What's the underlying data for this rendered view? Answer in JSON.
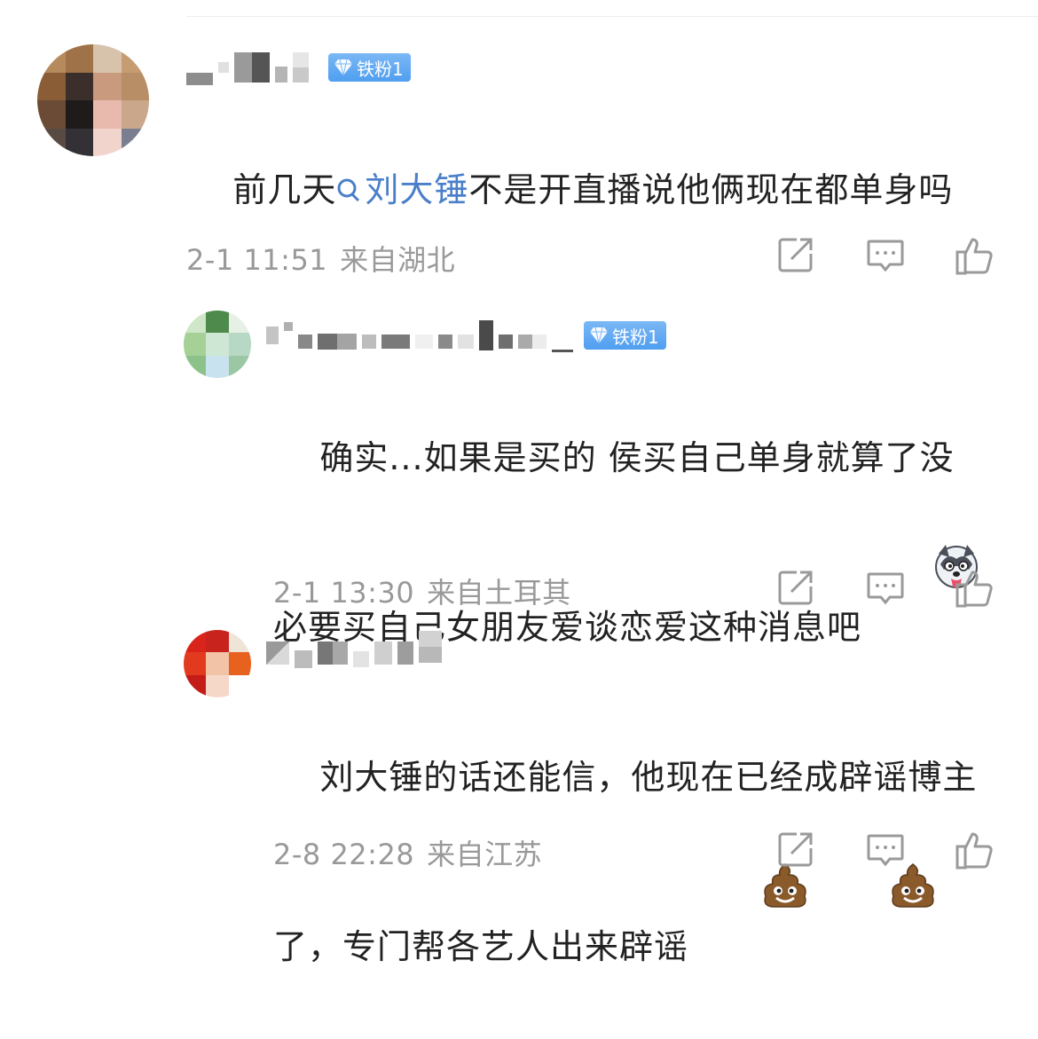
{
  "comments": [
    {
      "badge": "铁粉1",
      "text_before": "前几天",
      "link": "刘大锤",
      "text_after": "不是开直播说他俩现在都单身吗",
      "time": "2-1 11:51",
      "location": "来自湖北"
    },
    {
      "badge": "铁粉1",
      "text": "确实...如果是买的 侯买自己单身就算了没必要买自己女朋友爱谈恋爱这种消息吧",
      "emoji": "husky-emoji",
      "time": "2-1 13:30",
      "location": "来自土耳其"
    },
    {
      "text": "刘大锤的话还能信，他现在已经成辟谣博主了，专门帮各艺人出来辟谣",
      "emoji": "poop-emoji",
      "time": "2-8 22:28",
      "location": "来自江苏"
    }
  ],
  "icons": {
    "share": "share-icon",
    "comment": "comment-icon",
    "like": "thumbs-up-icon",
    "badge": "diamond-icon",
    "search": "search-icon"
  },
  "colors": {
    "link": "#4a7fc9",
    "meta": "#999999",
    "badge": "#5aa3f0"
  }
}
